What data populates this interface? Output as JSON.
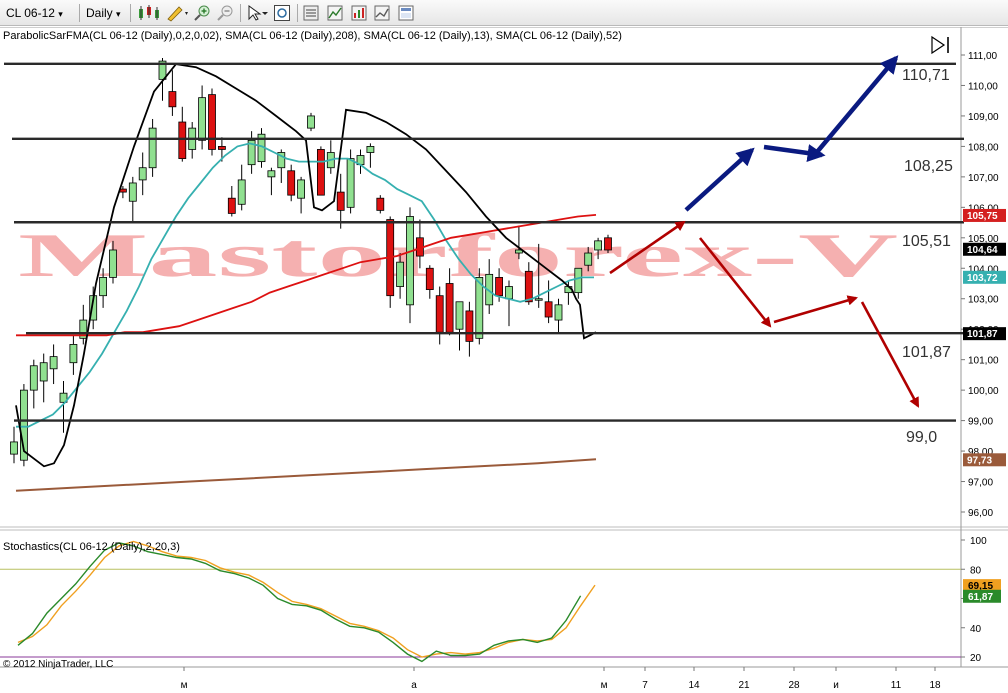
{
  "toolbar": {
    "instrument": "CL 06-12",
    "period": "Daily",
    "dropdown_glyph": "▾"
  },
  "main_panel": {
    "indicator_label": "ParabolicSarFMA(CL 06-12 (Daily),0,2,0,02), SMA(CL 06-12 (Daily),208), SMA(CL 06-12 (Daily),13), SMA(CL 06-12 (Daily),52)",
    "watermark": "Mastorforex-V",
    "level_labels": [
      "110,71",
      "108,25",
      "105,51",
      "101,87",
      "99,0"
    ],
    "price_axis": {
      "ticks": [
        "111,00",
        "110,00",
        "109,00",
        "108,00",
        "107,00",
        "106,00",
        "105,00",
        "104,00",
        "103,00",
        "102,00",
        "101,00",
        "100,00",
        "99,00",
        "98,00",
        "97,00",
        "96,00"
      ],
      "markers": [
        {
          "label": "105,75",
          "color": "#d42020"
        },
        {
          "label": "104,64",
          "color": "#000000"
        },
        {
          "label": "103,72",
          "color": "#36b0b0"
        },
        {
          "label": "101,87",
          "color": "#000000"
        },
        {
          "label": "97,73",
          "color": "#9a5a3a"
        }
      ]
    }
  },
  "stoch_panel": {
    "indicator_label": "Stochastics(CL 06-12 (Daily),2,20,3)",
    "ticks": [
      "100",
      "80",
      "60",
      "40",
      "20"
    ],
    "markers": [
      {
        "label": "69,15",
        "color": "#f0a020"
      },
      {
        "label": "61,87",
        "color": "#2a8a2a"
      }
    ]
  },
  "time_axis": {
    "labels": [
      "м",
      "а",
      "м",
      "7",
      "14",
      "21",
      "28",
      "и",
      "11",
      "18"
    ]
  },
  "copyright": "© 2012 NinjaTrader, LLC",
  "colors": {
    "bull": "#90e090",
    "bear": "#dd1111",
    "sma13": "#36b0b0",
    "sma52": "#dd1111",
    "sma208": "#9a5a3a",
    "sar": "#000000",
    "stoch_k": "#2a8a2a",
    "stoch_d": "#f0a020",
    "arrow_up": "#0a1a80",
    "arrow_down": "#b00000"
  },
  "chart_data": {
    "type": "candlestick",
    "instrument": "CL 06-12",
    "period": "Daily",
    "ylim": [
      95.5,
      111.5
    ],
    "candles": [
      {
        "o": 97.9,
        "h": 98.8,
        "l": 97.6,
        "c": 98.3
      },
      {
        "o": 97.7,
        "h": 100.2,
        "l": 97.5,
        "c": 100.0
      },
      {
        "o": 100.0,
        "h": 101.0,
        "l": 99.4,
        "c": 100.8
      },
      {
        "o": 100.3,
        "h": 101.2,
        "l": 99.6,
        "c": 100.9
      },
      {
        "o": 100.7,
        "h": 101.5,
        "l": 100.2,
        "c": 101.1
      },
      {
        "o": 99.6,
        "h": 100.3,
        "l": 98.6,
        "c": 99.9
      },
      {
        "o": 100.9,
        "h": 101.8,
        "l": 100.5,
        "c": 101.5
      },
      {
        "o": 101.7,
        "h": 102.8,
        "l": 101.5,
        "c": 102.3
      },
      {
        "o": 102.3,
        "h": 103.4,
        "l": 102.0,
        "c": 103.1
      },
      {
        "o": 103.1,
        "h": 104.0,
        "l": 102.7,
        "c": 103.7
      },
      {
        "o": 103.7,
        "h": 104.9,
        "l": 103.5,
        "c": 104.6
      },
      {
        "o": 106.6,
        "h": 106.7,
        "l": 106.3,
        "c": 106.5
      },
      {
        "o": 106.2,
        "h": 107.0,
        "l": 105.5,
        "c": 106.8
      },
      {
        "o": 106.9,
        "h": 107.8,
        "l": 106.4,
        "c": 107.3
      },
      {
        "o": 107.3,
        "h": 108.9,
        "l": 107.0,
        "c": 108.6
      },
      {
        "o": 110.2,
        "h": 110.9,
        "l": 109.5,
        "c": 110.8
      },
      {
        "o": 109.8,
        "h": 110.5,
        "l": 109.0,
        "c": 109.3
      },
      {
        "o": 108.8,
        "h": 109.3,
        "l": 107.5,
        "c": 107.6
      },
      {
        "o": 107.9,
        "h": 108.8,
        "l": 107.6,
        "c": 108.6
      },
      {
        "o": 108.2,
        "h": 110.0,
        "l": 107.9,
        "c": 109.6
      },
      {
        "o": 109.7,
        "h": 109.9,
        "l": 107.7,
        "c": 107.9
      },
      {
        "o": 108.0,
        "h": 108.3,
        "l": 107.5,
        "c": 107.9
      },
      {
        "o": 106.3,
        "h": 106.7,
        "l": 105.7,
        "c": 105.8
      },
      {
        "o": 106.1,
        "h": 107.4,
        "l": 105.9,
        "c": 106.9
      },
      {
        "o": 107.4,
        "h": 108.5,
        "l": 107.1,
        "c": 108.2
      },
      {
        "o": 107.5,
        "h": 108.6,
        "l": 107.3,
        "c": 108.4
      },
      {
        "o": 107.0,
        "h": 107.3,
        "l": 106.4,
        "c": 107.2
      },
      {
        "o": 107.3,
        "h": 107.9,
        "l": 106.8,
        "c": 107.8
      },
      {
        "o": 107.2,
        "h": 107.4,
        "l": 106.2,
        "c": 106.4
      },
      {
        "o": 106.3,
        "h": 107.0,
        "l": 105.8,
        "c": 106.9
      },
      {
        "o": 108.6,
        "h": 109.1,
        "l": 108.5,
        "c": 109.0
      },
      {
        "o": 107.9,
        "h": 108.0,
        "l": 106.4,
        "c": 106.4
      },
      {
        "o": 107.3,
        "h": 108.2,
        "l": 107.1,
        "c": 107.8
      },
      {
        "o": 106.5,
        "h": 107.1,
        "l": 105.3,
        "c": 105.9
      },
      {
        "o": 106.0,
        "h": 107.9,
        "l": 105.8,
        "c": 107.6
      },
      {
        "o": 107.4,
        "h": 107.9,
        "l": 107.1,
        "c": 107.7
      },
      {
        "o": 107.8,
        "h": 108.1,
        "l": 107.3,
        "c": 108.0
      },
      {
        "o": 106.3,
        "h": 106.4,
        "l": 105.8,
        "c": 105.9
      },
      {
        "o": 105.6,
        "h": 105.7,
        "l": 102.7,
        "c": 103.1
      },
      {
        "o": 103.4,
        "h": 104.5,
        "l": 103.0,
        "c": 104.2
      },
      {
        "o": 102.8,
        "h": 106.0,
        "l": 102.2,
        "c": 105.7
      },
      {
        "o": 105.0,
        "h": 105.6,
        "l": 104.0,
        "c": 104.4
      },
      {
        "o": 104.0,
        "h": 104.1,
        "l": 103.0,
        "c": 103.3
      },
      {
        "o": 103.1,
        "h": 103.4,
        "l": 101.5,
        "c": 101.9
      },
      {
        "o": 103.5,
        "h": 104.0,
        "l": 101.8,
        "c": 101.9
      },
      {
        "o": 102.0,
        "h": 102.9,
        "l": 101.3,
        "c": 102.9
      },
      {
        "o": 102.6,
        "h": 102.9,
        "l": 101.1,
        "c": 101.6
      },
      {
        "o": 101.7,
        "h": 104.0,
        "l": 101.5,
        "c": 103.7
      },
      {
        "o": 102.8,
        "h": 104.3,
        "l": 102.5,
        "c": 103.8
      },
      {
        "o": 103.7,
        "h": 104.0,
        "l": 102.9,
        "c": 103.1
      },
      {
        "o": 103.0,
        "h": 103.6,
        "l": 102.1,
        "c": 103.4
      },
      {
        "o": 104.5,
        "h": 105.4,
        "l": 104.3,
        "c": 104.6
      },
      {
        "o": 103.9,
        "h": 104.2,
        "l": 102.8,
        "c": 102.9
      },
      {
        "o": 103.0,
        "h": 104.8,
        "l": 102.7,
        "c": 103.0
      },
      {
        "o": 102.9,
        "h": 103.6,
        "l": 102.2,
        "c": 102.4
      },
      {
        "o": 102.3,
        "h": 103.0,
        "l": 101.9,
        "c": 102.8
      },
      {
        "o": 103.2,
        "h": 103.6,
        "l": 102.8,
        "c": 103.4
      },
      {
        "o": 103.2,
        "h": 104.0,
        "l": 103.0,
        "c": 104.0
      },
      {
        "o": 104.1,
        "h": 104.7,
        "l": 103.9,
        "c": 104.5
      },
      {
        "o": 104.6,
        "h": 105.0,
        "l": 104.3,
        "c": 104.9
      },
      {
        "o": 105.0,
        "h": 105.1,
        "l": 104.5,
        "c": 104.6
      }
    ],
    "horizontal_levels": [
      110.71,
      108.25,
      105.51,
      101.87,
      99.0
    ],
    "sma13": [
      98.8,
      98.8,
      99.0,
      99.2,
      99.6,
      100.1,
      100.6,
      101.2,
      101.9,
      102.6,
      103.4,
      104.3,
      105.0,
      105.7,
      106.3,
      106.8,
      107.3,
      107.7,
      108.0,
      108.1,
      108.0,
      107.8,
      107.6,
      107.5,
      107.5,
      107.5,
      107.6,
      107.6,
      107.4,
      107.1,
      106.9,
      106.6,
      106.4,
      106.2,
      105.6,
      104.9,
      104.3,
      103.8,
      103.4,
      103.1,
      103.0,
      102.9,
      103.0,
      103.2,
      103.4,
      103.6,
      103.7,
      103.7
    ],
    "sma52": [
      101.8,
      101.8,
      101.8,
      101.8,
      101.8,
      101.8,
      101.9,
      101.9,
      102.0,
      102.1,
      102.3,
      102.5,
      102.7,
      102.9,
      103.2,
      103.4,
      103.6,
      103.8,
      104.0,
      104.2,
      104.3,
      104.4,
      104.6,
      104.8,
      105.0,
      105.1,
      105.2,
      105.3,
      105.4,
      105.5,
      105.6,
      105.7,
      105.75
    ],
    "sma208": [
      96.7,
      96.8,
      96.9,
      97.0,
      97.1,
      97.2,
      97.3,
      97.4,
      97.5,
      97.6,
      97.73
    ],
    "stochastics": {
      "ylim": [
        10,
        105
      ],
      "levels": [
        20,
        80
      ],
      "k": [
        28,
        36,
        50,
        60,
        70,
        82,
        93,
        98,
        96,
        92,
        90,
        88,
        87,
        84,
        79,
        77,
        74,
        69,
        60,
        56,
        55,
        52,
        46,
        41,
        40,
        37,
        30,
        22,
        17,
        24,
        21,
        21,
        22,
        28,
        31,
        32,
        30,
        33,
        45,
        61.87
      ],
      "d": [
        30,
        34,
        42,
        55,
        65,
        76,
        88,
        96,
        99,
        96,
        92,
        89,
        88,
        86,
        81,
        78,
        76,
        71,
        64,
        58,
        56,
        53,
        48,
        43,
        41,
        38,
        33,
        25,
        20,
        22,
        23,
        22,
        23,
        26,
        30,
        32,
        31,
        32,
        40,
        55,
        69.15
      ]
    }
  }
}
